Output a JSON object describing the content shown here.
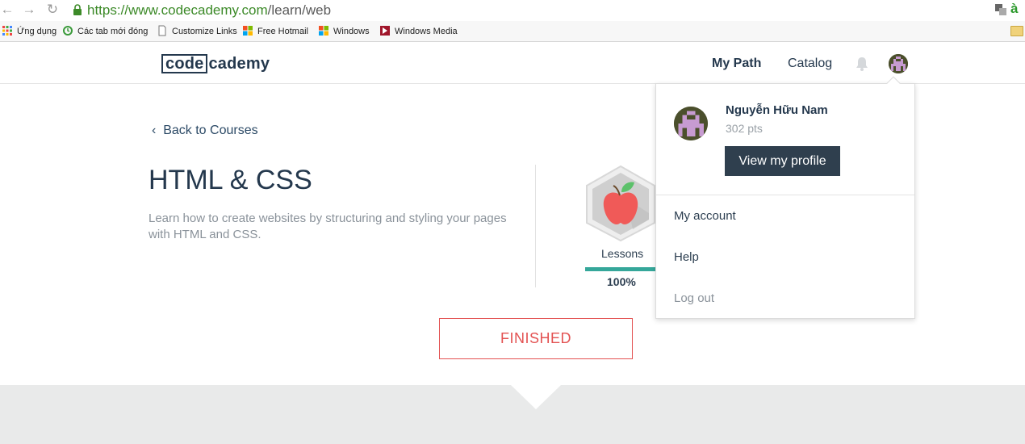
{
  "browser": {
    "url_scheme_host": "https://www.codecademy.com",
    "url_path": "/learn/web",
    "bookmarks": [
      {
        "label": "Ứng dụng",
        "icon": "apps-grid-icon"
      },
      {
        "label": "Các tab mới đóng",
        "icon": "recent-tabs-icon"
      },
      {
        "label": "Customize Links",
        "icon": "page-icon"
      },
      {
        "label": "Free Hotmail",
        "icon": "windows-logo-icon"
      },
      {
        "label": "Windows",
        "icon": "windows-logo-icon"
      },
      {
        "label": "Windows Media",
        "icon": "windows-media-icon"
      }
    ]
  },
  "header": {
    "logo_box": "code",
    "logo_tail": "cademy",
    "nav": {
      "my_path": "My Path",
      "catalog": "Catalog"
    }
  },
  "course": {
    "back_label": "Back to Courses",
    "title": "HTML & CSS",
    "description": "Learn how to create websites by structuring and styling your pages with HTML and CSS.",
    "lessons_label": "Lessons",
    "progress_percent": "100%",
    "progress_fraction": 1.0,
    "status_label": "FINISHED"
  },
  "dropdown": {
    "user_name": "Nguyễn Hữu Nam",
    "points": "302 pts",
    "profile_button": "View my profile",
    "items": [
      "My account",
      "Help",
      "Log out"
    ]
  },
  "colors": {
    "brand_dark": "#24384d",
    "progress": "#35a79a",
    "finished": "#e35252",
    "url_green": "#3c8a28"
  }
}
